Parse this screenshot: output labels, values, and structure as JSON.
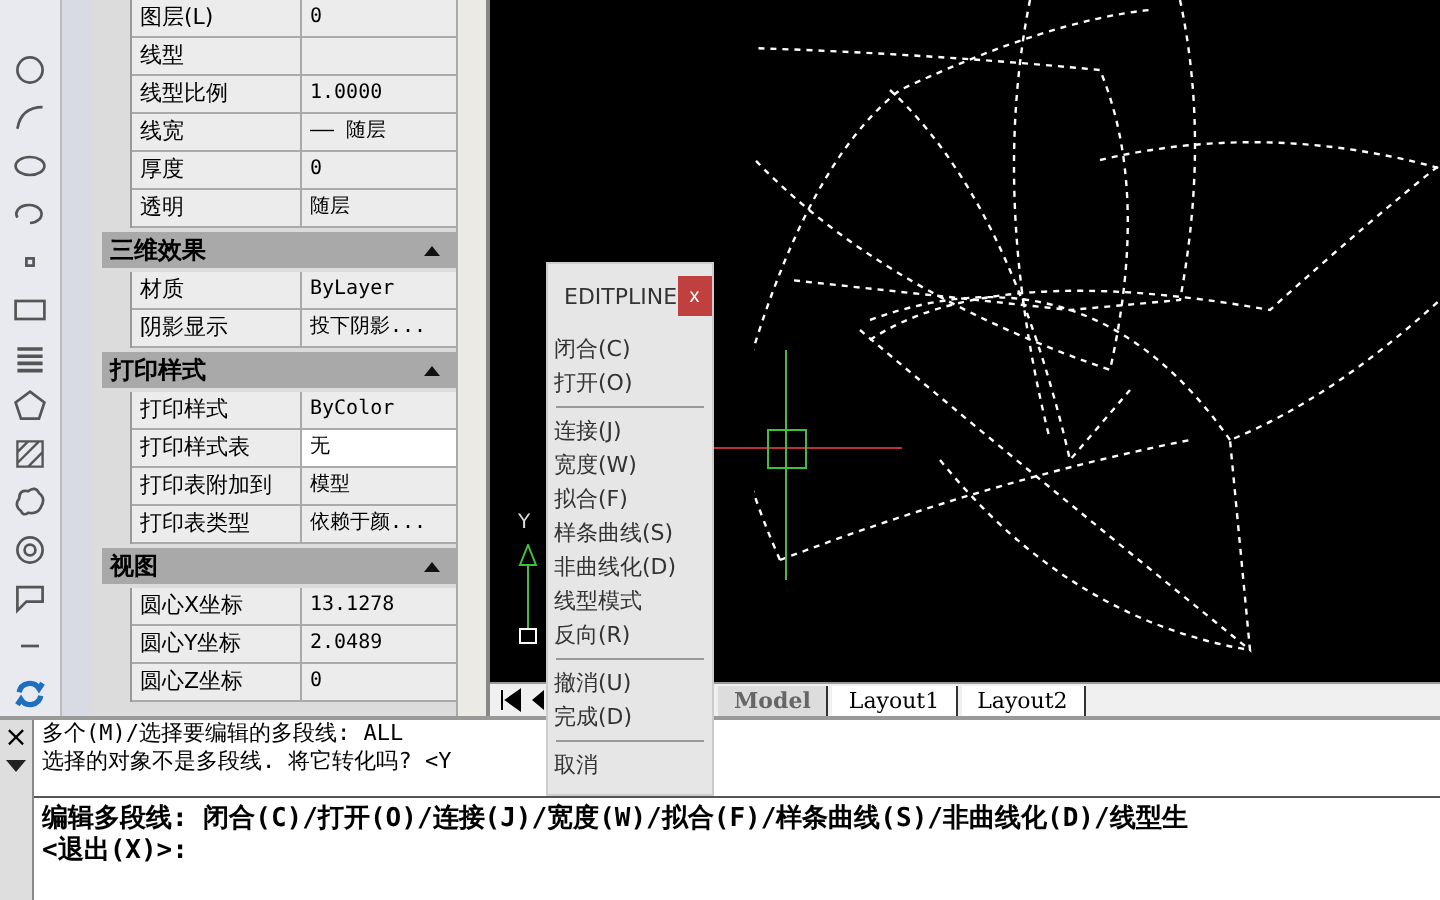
{
  "properties": {
    "general_rows": [
      {
        "label": "图层(L)",
        "value": "0"
      },
      {
        "label": "线型"
      },
      {
        "label": "线型比例",
        "value": "1.0000"
      },
      {
        "label": "线宽",
        "value": "—— 随层"
      },
      {
        "label": "厚度",
        "value": "0"
      },
      {
        "label": "透明",
        "value": "随层"
      }
    ],
    "sections": [
      {
        "title": "三维效果",
        "expanded": true,
        "rows": [
          {
            "label": "材质",
            "value": "ByLayer"
          },
          {
            "label": "阴影显示",
            "value": "投下阴影..."
          }
        ]
      },
      {
        "title": "打印样式",
        "expanded": true,
        "rows": [
          {
            "label": "打印样式",
            "value": "ByColor"
          },
          {
            "label": "打印样式表",
            "value": "无",
            "selected": true
          },
          {
            "label": "打印表附加到",
            "value": "模型"
          },
          {
            "label": "打印表类型",
            "value": "依赖于颜..."
          }
        ]
      },
      {
        "title": "视图",
        "expanded": true,
        "rows": [
          {
            "label": "圆心X坐标",
            "value": "13.1278"
          },
          {
            "label": "圆心Y坐标",
            "value": "2.0489"
          },
          {
            "label": "圆心Z坐标",
            "value": "0"
          }
        ]
      }
    ]
  },
  "canvas": {
    "ucs_label": "Y"
  },
  "layout_tabs": [
    {
      "label": "Model",
      "selected": true
    },
    {
      "label": "Layout1",
      "selected": false
    },
    {
      "label": "Layout2",
      "selected": false
    }
  ],
  "context_menu": {
    "title": "EDITPLINE",
    "close": "x",
    "items": [
      {
        "kind": "item",
        "label": "闭合(C)"
      },
      {
        "kind": "item",
        "label": "打开(O)"
      },
      {
        "kind": "separator"
      },
      {
        "kind": "item",
        "label": "连接(J)"
      },
      {
        "kind": "item",
        "label": "宽度(W)"
      },
      {
        "kind": "item",
        "label": "拟合(F)"
      },
      {
        "kind": "item",
        "label": "样条曲线(S)"
      },
      {
        "kind": "item",
        "label": "非曲线化(D)"
      },
      {
        "kind": "item",
        "label": "线型模式"
      },
      {
        "kind": "item",
        "label": "反向(R)"
      },
      {
        "kind": "separator"
      },
      {
        "kind": "item",
        "label": "撤消(U)"
      },
      {
        "kind": "item",
        "label": "完成(D)"
      },
      {
        "kind": "separator"
      },
      {
        "kind": "item",
        "label": "取消"
      }
    ]
  },
  "command_line": {
    "close": "×",
    "history": [
      "多个(M)/选择要编辑的多段线: ALL",
      "选择的对象不是多段线. 将它转化吗? <Y"
    ],
    "prompt": [
      "编辑多段线: 闭合(C)/打开(O)/连接(J)/宽度(W)/拟合(F)/样条曲线(S)/非曲线化(D)/线型生",
      "<退出(X)>:"
    ]
  }
}
